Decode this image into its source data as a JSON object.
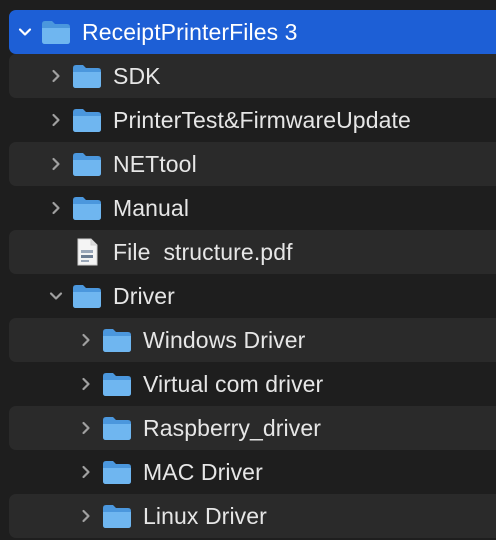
{
  "finder": {
    "root": {
      "label": "ReceiptPrinterFiles 3",
      "expanded": true,
      "selected": true,
      "icon": "folder-icon"
    },
    "items": [
      {
        "label": "SDK",
        "level": 1,
        "expanded": false,
        "icon": "folder-icon"
      },
      {
        "label": "PrinterTest&FirmwareUpdate",
        "level": 1,
        "expanded": false,
        "icon": "folder-icon"
      },
      {
        "label": "NETtool",
        "level": 1,
        "expanded": false,
        "icon": "folder-icon"
      },
      {
        "label": "Manual",
        "level": 1,
        "expanded": false,
        "icon": "folder-icon"
      },
      {
        "label": "File  structure.pdf",
        "level": 1,
        "expanded": null,
        "icon": "pdf-file-icon"
      },
      {
        "label": "Driver",
        "level": 1,
        "expanded": true,
        "icon": "folder-icon"
      },
      {
        "label": "Windows Driver",
        "level": 2,
        "expanded": false,
        "icon": "folder-icon"
      },
      {
        "label": "Virtual com driver",
        "level": 2,
        "expanded": false,
        "icon": "folder-icon"
      },
      {
        "label": "Raspberry_driver",
        "level": 2,
        "expanded": false,
        "icon": "folder-icon"
      },
      {
        "label": "MAC Driver",
        "level": 2,
        "expanded": false,
        "icon": "folder-icon"
      },
      {
        "label": "Linux Driver",
        "level": 2,
        "expanded": false,
        "icon": "folder-icon"
      }
    ]
  },
  "colors": {
    "selection": "#1d5fd6",
    "background": "#1e1e1e",
    "alt_row": "#2a2a2a",
    "folder": "#5aa9ea",
    "text": "#e6e6e6"
  }
}
